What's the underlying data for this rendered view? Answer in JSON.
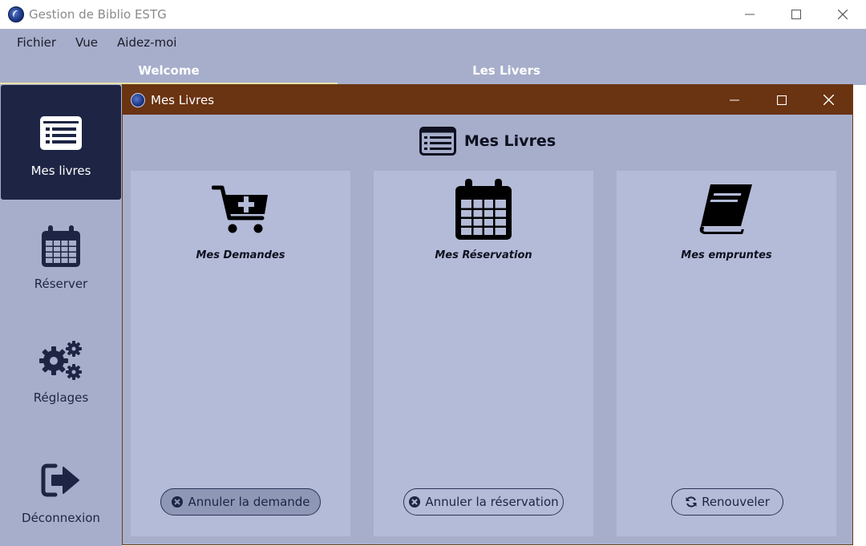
{
  "window": {
    "title": "Gestion de Biblio ESTG",
    "logo_icon": "globe-logo-icon"
  },
  "menu": {
    "items": [
      "Fichier",
      "Vue",
      "Aidez-moi"
    ]
  },
  "tabs": [
    {
      "label": "Welcome",
      "active": true
    },
    {
      "label": "Les Livers",
      "active": false
    }
  ],
  "sidebar": {
    "items": [
      {
        "label": "Mes livres",
        "icon": "list-icon",
        "active": true
      },
      {
        "label": "Réserver",
        "icon": "calendar-icon",
        "active": false
      },
      {
        "label": "Réglages",
        "icon": "gears-icon",
        "active": false
      },
      {
        "label": "Déconnexion",
        "icon": "sign-out-icon",
        "active": false
      }
    ]
  },
  "inner_window": {
    "title": "Mes Livres",
    "header": "Mes Livres",
    "panels": [
      {
        "title": "Mes Demandes",
        "icon": "cart-plus-icon",
        "button": "Annuler la demande",
        "button_icon": "cancel-circle-icon"
      },
      {
        "title": "Mes Réservation",
        "icon": "calendar-icon",
        "button": "Annuler la réservation",
        "button_icon": "cancel-circle-icon"
      },
      {
        "title": "Mes empruntes",
        "icon": "book-icon",
        "button": "Renouveler",
        "button_icon": "refresh-icon"
      }
    ]
  },
  "colors": {
    "chrome": "#a7aecb",
    "panel": "#b4bbd8",
    "sidebar_active": "#1e2444",
    "inner_titlebar": "#6a3311",
    "tab_underline": "#e9e2a6"
  }
}
